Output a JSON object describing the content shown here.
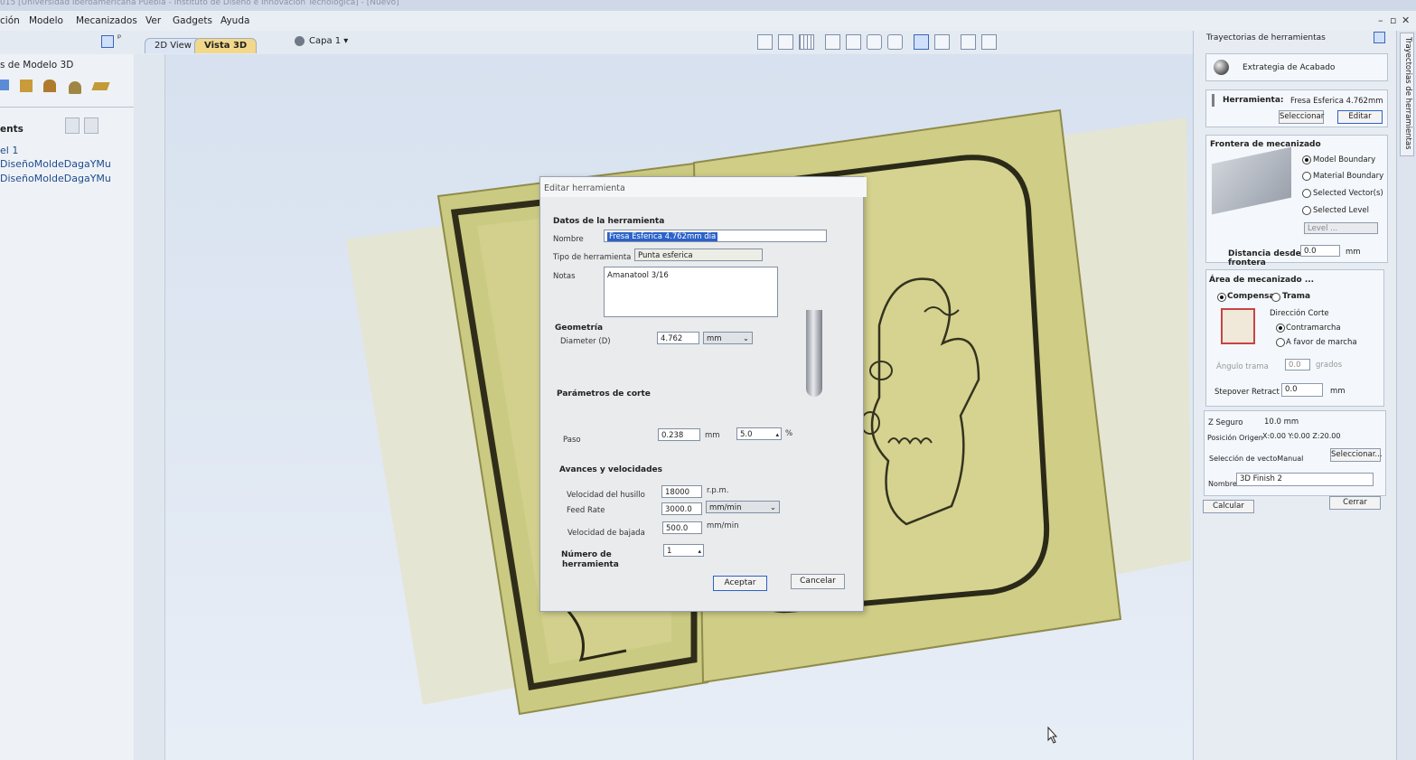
{
  "titlebar": {
    "text": "015 [Universidad Iberoamericana Puebla - Instituto de Diseño e Innovación Tecnológica] - [Nuevo]"
  },
  "menu": [
    "ción",
    "Modelo",
    "Mecanizados",
    "Ver",
    "Gadgets",
    "Ayuda"
  ],
  "window_controls": [
    "–",
    "▫",
    "✕"
  ],
  "view_tabs": {
    "tab_2d": "2D View",
    "tab_3d": "Vista 3D",
    "layer": "Capa 1 ▾"
  },
  "left_panel": {
    "title": "s de Modelo 3D",
    "section": "ents",
    "tree": [
      "el 1",
      "DiseñoMoldeDagaYMu",
      "DiseñoMoldeDagaYMu"
    ]
  },
  "right_panel": {
    "header": "Trayectorias de herramientas",
    "vertical_tab": "Trayectorias de herramientas",
    "strategy": "Extrategia de Acabado",
    "tool_label": "Herramienta:",
    "tool_value": "Fresa Esferica 4.762mm",
    "select_btn": "Seleccionar",
    "edit_btn": "Editar",
    "boundary_title": "Frontera de mecanizado",
    "boundary_options": [
      "Model Boundary",
      "Material Boundary",
      "Selected Vector(s)",
      "Selected Level"
    ],
    "level_placeholder": "Level ...",
    "distance_label_1": "Distancia desde",
    "distance_label_2": "frontera",
    "distance_value": "0.0",
    "distance_unit": "mm",
    "area_title": "Área de mecanizado ...",
    "area_opt_1": "Compensa",
    "area_opt_2": "Trama",
    "cut_dir_title": "Dirección Corte",
    "cut_dir_1": "Contramarcha",
    "cut_dir_2": "A favor de marcha",
    "raster_angle_label": "Ángulo trama",
    "raster_angle_value": "0.0",
    "raster_angle_unit": "grados",
    "stepover_label": "Stepover Retract",
    "stepover_value": "0.0",
    "stepover_unit": "mm",
    "z_safe_label": "Z Seguro",
    "z_safe_value": "10.0 mm",
    "origin_label": "Posición Origen",
    "origin_value": "X:0.00 Y:0.00 Z:20.00",
    "vector_sel_label": "Selección de vectoManual",
    "vector_sel_btn": "Seleccionar...",
    "name_label": "Nombre:",
    "name_value": "3D Finish 2",
    "calc_btn": "Calcular",
    "close_btn": "Cerrar"
  },
  "dialog": {
    "title": "Editar herramienta",
    "section_tool": "Datos de la herramienta",
    "name_label": "Nombre",
    "name_value": "Fresa Esferica 4.762mm dia",
    "type_label": "Tipo de herramienta",
    "type_value": "Punta esferica",
    "notes_label": "Notas",
    "notes_value": "Amanatool 3/16",
    "section_geom": "Geometría",
    "diameter_label": "Diameter (D)",
    "diameter_value": "4.762",
    "diameter_unit": "mm",
    "section_cut": "Parámetros de corte",
    "step_label": "Paso",
    "step_value": "0.238",
    "step_unit": "mm",
    "step_pct": "5.0",
    "step_pct_unit": "%",
    "section_feeds": "Avances y velocidades",
    "spindle_label": "Velocidad del husillo",
    "spindle_value": "18000",
    "spindle_unit": "r.p.m.",
    "feed_label": "Feed Rate",
    "feed_value": "3000.0",
    "feed_unit": "mm/min",
    "plunge_label": "Velocidad de bajada",
    "plunge_value": "500.0",
    "plunge_unit": "mm/min",
    "toolnum_label_1": "Número de",
    "toolnum_label_2": "herramienta",
    "toolnum_value": "1",
    "ok_btn": "Aceptar",
    "cancel_btn": "Cancelar"
  },
  "colors": {
    "model": "#cfcd86",
    "model_dark": "#8f8c4a",
    "accent": "#2b62c9"
  }
}
